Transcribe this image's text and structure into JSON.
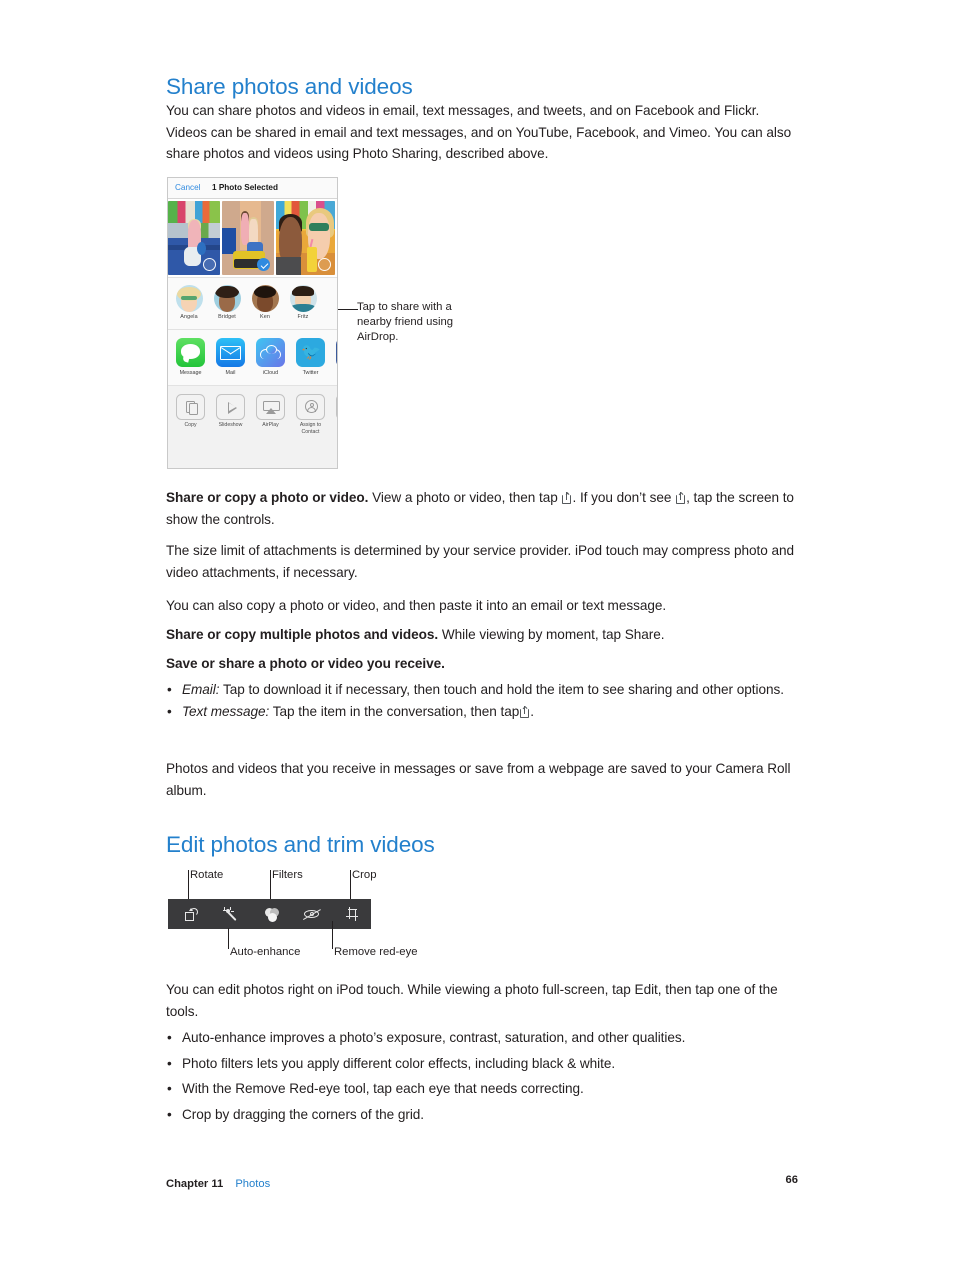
{
  "page": {
    "number": "66",
    "chapter_label": "Chapter",
    "chapter_number": "11",
    "chapter_link": "Photos",
    "heading_color": "#2380cc",
    "text_color": "#231f20"
  },
  "sections": [
    {
      "heading": "Share photos and videos",
      "intro": "You can share photos and videos in email, text messages, and tweets, and on Facebook and Flickr. Videos can be shared in email and text messages, and on YouTube, Facebook, and Vimeo. You can also share photos and videos using Photo Sharing, described above."
    },
    {
      "heading": "Edit photos and trim videos"
    }
  ],
  "share_figure": {
    "nav": {
      "cancel": "Cancel",
      "title": "1 Photo Selected"
    },
    "photos": [
      {
        "alt": "girl-on-blue-bench",
        "selected": false
      },
      {
        "alt": "two-girls-on-cart",
        "selected": true
      },
      {
        "alt": "two-people-with-drinks",
        "selected": false
      }
    ],
    "airdrop_contacts": [
      {
        "name": "Angela"
      },
      {
        "name": "Bridget"
      },
      {
        "name": "Ken"
      },
      {
        "name": "Fritz"
      }
    ],
    "apps": [
      {
        "label": "Message",
        "icon": "message-icon"
      },
      {
        "label": "Mail",
        "icon": "mail-icon"
      },
      {
        "label": "iCloud",
        "icon": "icloud-icon"
      },
      {
        "label": "Twitter",
        "icon": "twitter-icon"
      },
      {
        "label": "",
        "icon": "facebook-icon"
      }
    ],
    "actions": [
      {
        "label": "Copy",
        "icon": "copy-icon"
      },
      {
        "label": "Slideshow",
        "icon": "play-icon"
      },
      {
        "label": "AirPlay",
        "icon": "airplay-icon"
      },
      {
        "label": "Assign to Contact",
        "icon": "person-icon"
      }
    ],
    "callout": "Tap to share with a nearby friend using AirDrop."
  },
  "body": {
    "share_copy_lead": "Share or copy a photo or video.",
    "share_copy_part1": "View a photo or video, then tap",
    "share_copy_part2": ". If you don’t see",
    "share_copy_part3": ", tap the screen to show the controls.",
    "size_limit": "The size limit of attachments is determined by your service provider. iPod touch may compress photo and video attachments, if necessary.",
    "copy_paste": "You can also copy a photo or video, and then paste it into an email or text message.",
    "share_multiple_lead": "Share or copy multiple photos and videos.",
    "share_multiple_rest": "While viewing by moment, tap Share.",
    "save_share_lead": "Save or share a photo or video you receive.",
    "bullets_receive": [
      {
        "term": "Email:",
        "text": "Tap to download it if necessary, then touch and hold the item to see sharing and other options."
      },
      {
        "term": "Text message:",
        "text": "Tap the item in the conversation, then tap",
        "trailing": "."
      }
    ],
    "camera_roll": "Photos and videos that you receive in messages or save from a webpage are saved to your Camera Roll album.",
    "edit_intro": "You can edit photos right on iPod touch. While viewing a photo full-screen, tap Edit, then tap one of the tools.",
    "edit_bullets": [
      "Auto-enhance improves a photo’s exposure, contrast, saturation, and other qualities.",
      "Photo filters lets you apply different color effects, including black & white.",
      "With the Remove Red-eye tool, tap each eye that needs correcting.",
      "Crop by dragging the corners of the grid."
    ]
  },
  "edit_figure": {
    "bar_color": "#3a3a3c",
    "tools": [
      {
        "name": "rotate-tool",
        "label": "Rotate"
      },
      {
        "name": "auto-enhance-tool",
        "label": "Auto-enhance"
      },
      {
        "name": "filters-tool",
        "label": "Filters"
      },
      {
        "name": "remove-red-eye-tool",
        "label": "Remove red-eye"
      },
      {
        "name": "crop-tool",
        "label": "Crop"
      }
    ]
  }
}
